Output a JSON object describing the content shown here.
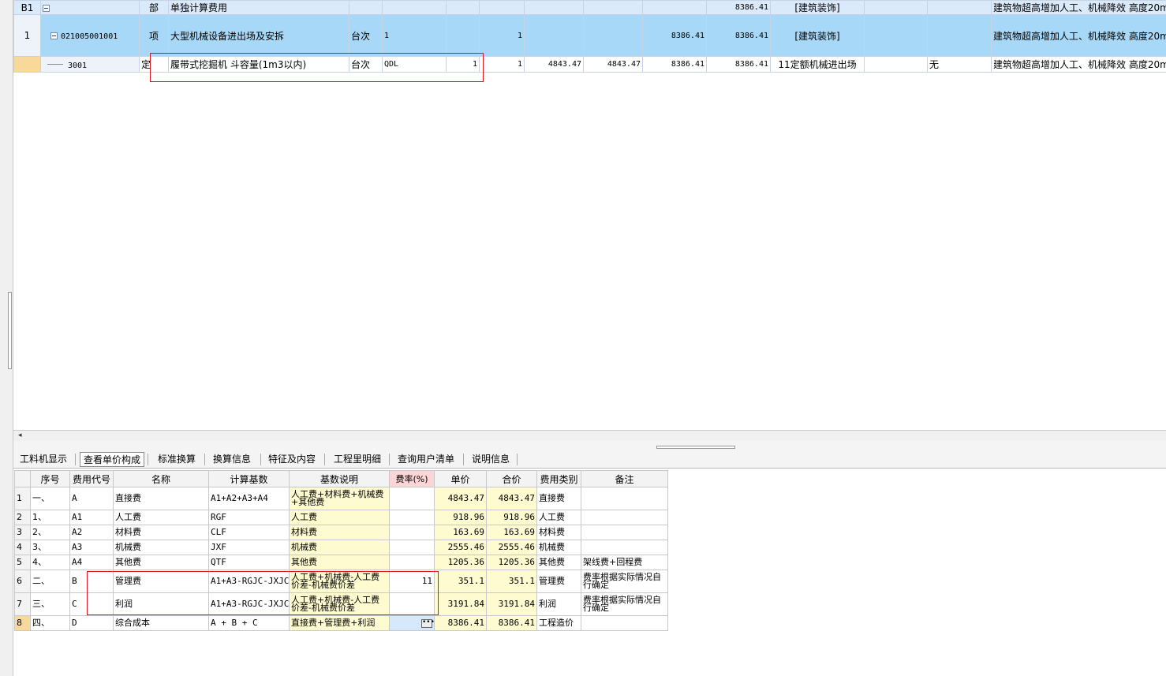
{
  "top_grid": {
    "rows": [
      {
        "rownum": "B1",
        "code": "",
        "type": "部",
        "name": "单独计算费用",
        "unit": "",
        "qty_expr": "",
        "qty": "",
        "work_qty": "",
        "unit_price": "",
        "total": "",
        "price1": "",
        "price2": "8386.41",
        "major": "[建筑装饰]",
        "c1": "",
        "c2": "",
        "remark": "建筑物超高增加人工、机械降效 高度20m"
      },
      {
        "rownum": "1",
        "code": "021005001001",
        "type": "项",
        "name": "大型机械设备进出场及安拆",
        "unit": "台次",
        "qty_expr": "1",
        "qty": "",
        "work_qty": "1",
        "unit_price": "",
        "total": "",
        "price1": "8386.41",
        "price2": "8386.41",
        "major": "[建筑装饰]",
        "c1": "",
        "c2": "",
        "remark": "建筑物超高增加人工、机械降效 高度20m"
      },
      {
        "rownum": "",
        "code": "3001",
        "type": "定",
        "name": "履带式挖掘机 斗容量(1m3以内)",
        "unit": "台次",
        "qty_expr": "QDL",
        "qty": "1",
        "work_qty": "1",
        "unit_price": "4843.47",
        "total": "4843.47",
        "price1": "8386.41",
        "price2": "8386.41",
        "major": "11定额机械进出场",
        "c1": "",
        "c2": "无",
        "remark": "建筑物超高增加人工、机械降效 高度20m"
      }
    ]
  },
  "tabs": [
    "工料机显示",
    "查看单价构成",
    "标准换算",
    "换算信息",
    "特征及内容",
    "工程里明细",
    "查询用户清单",
    "说明信息"
  ],
  "active_tab": "查看单价构成",
  "cost_table": {
    "headers": [
      "",
      "序号",
      "费用代号",
      "名称",
      "计算基数",
      "基数说明",
      "费率(%)",
      "单价",
      "合价",
      "费用类别",
      "备注"
    ],
    "rows": [
      {
        "no": "1",
        "seq": "一、",
        "code": "A",
        "name": "直接费",
        "base": "A1+A2+A3+A4",
        "desc": "人工费+材料费+机械费+其他费",
        "rate": "",
        "unit": "4843.47",
        "total": "4843.47",
        "cat": "直接费",
        "note": ""
      },
      {
        "no": "2",
        "seq": "1、",
        "code": "A1",
        "name": "人工费",
        "base": "RGF",
        "desc": "人工费",
        "rate": "",
        "unit": "918.96",
        "total": "918.96",
        "cat": "人工费",
        "note": ""
      },
      {
        "no": "3",
        "seq": "2、",
        "code": "A2",
        "name": "材料费",
        "base": "CLF",
        "desc": "材料费",
        "rate": "",
        "unit": "163.69",
        "total": "163.69",
        "cat": "材料费",
        "note": ""
      },
      {
        "no": "4",
        "seq": "3、",
        "code": "A3",
        "name": "机械费",
        "base": "JXF",
        "desc": "机械费",
        "rate": "",
        "unit": "2555.46",
        "total": "2555.46",
        "cat": "机械费",
        "note": ""
      },
      {
        "no": "5",
        "seq": "4、",
        "code": "A4",
        "name": "其他费",
        "base": "QTF",
        "desc": "其他费",
        "rate": "",
        "unit": "1205.36",
        "total": "1205.36",
        "cat": "其他费",
        "note": "架线费+回程费"
      },
      {
        "no": "6",
        "seq": "二、",
        "code": "B",
        "name": "管理费",
        "base": "A1+A3-RGJC-JXJC",
        "desc": "人工费+机械费-人工费价差-机械费价差",
        "rate": "11",
        "unit": "351.1",
        "total": "351.1",
        "cat": "管理费",
        "note": "费率根据实际情况自行确定"
      },
      {
        "no": "7",
        "seq": "三、",
        "code": "C",
        "name": "利润",
        "base": "A1+A3-RGJC-JXJC",
        "desc": "人工费+机械费-人工费价差-机械费价差",
        "rate": "",
        "unit": "3191.84",
        "total": "3191.84",
        "cat": "利润",
        "note": "费率根据实际情况自行确定"
      },
      {
        "no": "8",
        "seq": "四、",
        "code": "D",
        "name": "综合成本",
        "base": "A + B + C",
        "desc": "直接费+管理费+利润",
        "rate": "",
        "unit": "8386.41",
        "total": "8386.41",
        "cat": "工程造价",
        "note": ""
      }
    ]
  },
  "icons": {
    "expander": "collapse-box-icon",
    "ellipsis": "ellipsis-button-icon"
  },
  "colors": {
    "selected_row": "#a8d8f8",
    "highlight_box": "#e0141e",
    "yellow_cell": "#fffbd0",
    "rate_header": "#fcd6d6"
  }
}
